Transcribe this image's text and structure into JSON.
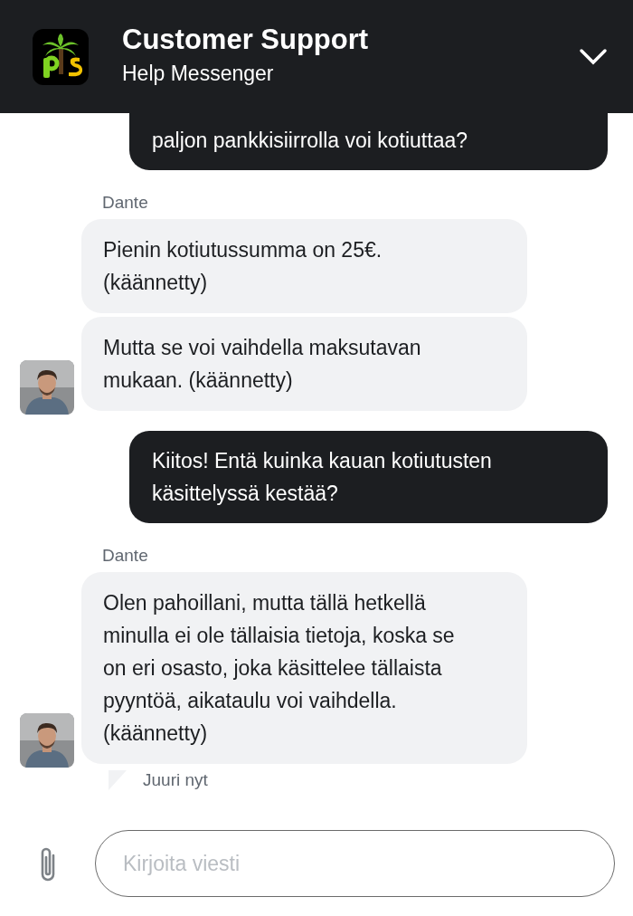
{
  "header": {
    "title": "Customer Support",
    "subtitle": "Help Messenger"
  },
  "messages": [
    {
      "kind": "outgoing",
      "text": "paljon pankkisiirrolla voi kotiuttaa?"
    },
    {
      "kind": "incoming",
      "sender": "Dante",
      "bubbles": [
        "Pienin kotiutussumma on 25€.\n(käännetty)",
        "Mutta se voi vaihdella maksutavan\nmukaan. (käännetty)"
      ]
    },
    {
      "kind": "outgoing",
      "text": "Kiitos! Entä kuinka kauan kotiutusten\nkäsittelyssä kestää?"
    },
    {
      "kind": "incoming",
      "sender": "Dante",
      "bubbles": [
        "Olen pahoillani, mutta tällä hetkellä\nminulla ei ole tällaisia tietoja, koska se\non eri osasto, joka käsittelee tällaista\npyyntöä, aikataulu voi vaihdella.\n(käännetty)"
      ],
      "time": "Juuri nyt"
    }
  ],
  "composer": {
    "placeholder": "Kirjoita viesti"
  }
}
